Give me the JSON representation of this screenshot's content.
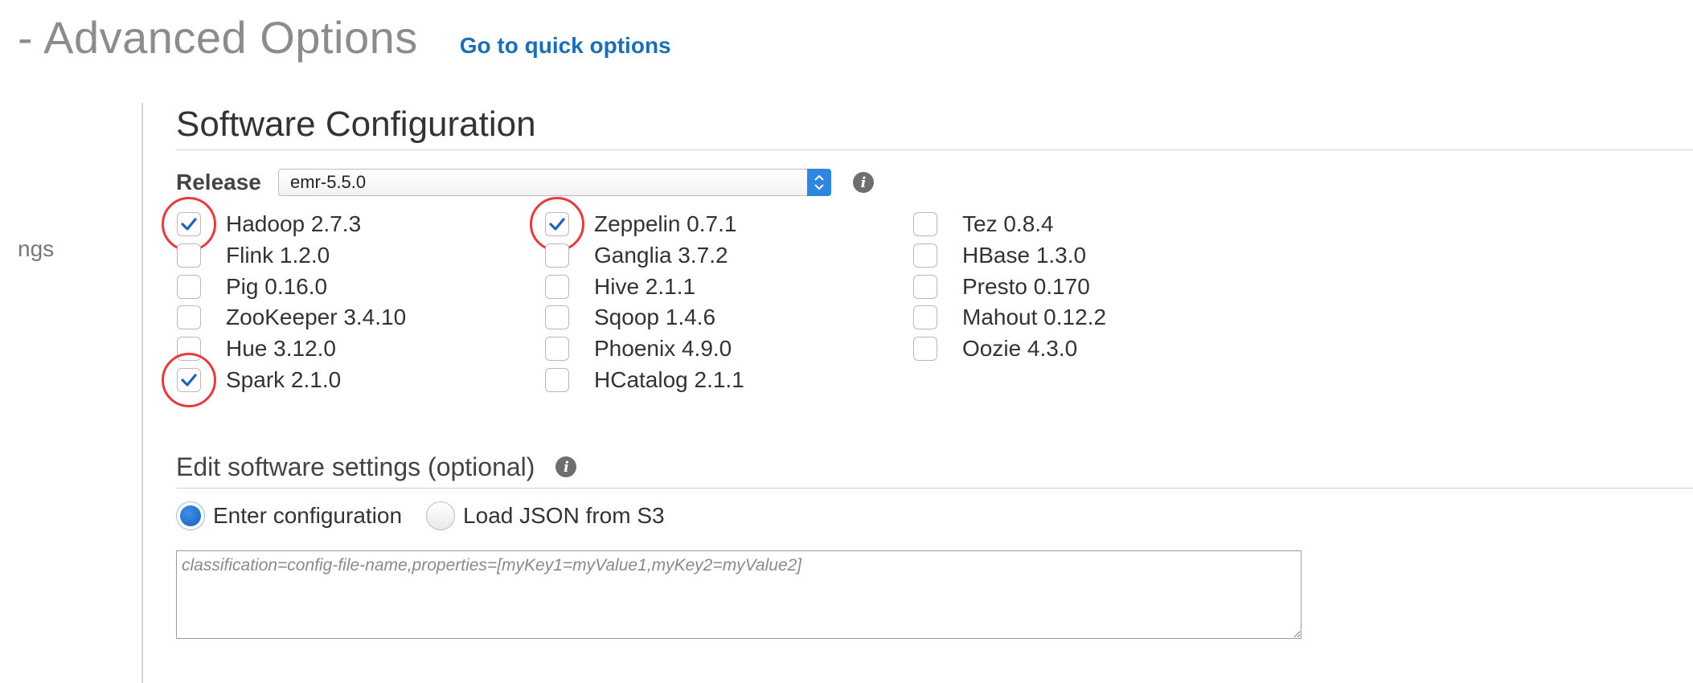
{
  "header": {
    "title": "- Advanced Options",
    "quick_link": "Go to quick options"
  },
  "sidebar": {
    "partial_label": "ngs"
  },
  "software_config": {
    "title": "Software Configuration",
    "release_label": "Release",
    "release_value": "emr-5.5.0",
    "applications": [
      {
        "label": "Hadoop 2.7.3",
        "checked": true,
        "highlighted": true
      },
      {
        "label": "Zeppelin 0.7.1",
        "checked": true,
        "highlighted": true
      },
      {
        "label": "Tez 0.8.4",
        "checked": false
      },
      {
        "label": "Flink 1.2.0",
        "checked": false
      },
      {
        "label": "Ganglia 3.7.2",
        "checked": false
      },
      {
        "label": "HBase 1.3.0",
        "checked": false
      },
      {
        "label": "Pig 0.16.0",
        "checked": false
      },
      {
        "label": "Hive 2.1.1",
        "checked": false
      },
      {
        "label": "Presto 0.170",
        "checked": false
      },
      {
        "label": "ZooKeeper 3.4.10",
        "checked": false
      },
      {
        "label": "Sqoop 1.4.6",
        "checked": false
      },
      {
        "label": "Mahout 0.12.2",
        "checked": false
      },
      {
        "label": "Hue 3.12.0",
        "checked": false
      },
      {
        "label": "Phoenix 4.9.0",
        "checked": false
      },
      {
        "label": "Oozie 4.3.0",
        "checked": false
      },
      {
        "label": "Spark 2.1.0",
        "checked": true,
        "highlighted": true
      },
      {
        "label": "HCatalog 2.1.1",
        "checked": false
      }
    ]
  },
  "edit_settings": {
    "title": "Edit software settings (optional)",
    "options": [
      {
        "label": "Enter configuration",
        "selected": true
      },
      {
        "label": "Load JSON from S3",
        "selected": false
      }
    ],
    "config_placeholder": "classification=config-file-name,properties=[myKey1=myValue1,myKey2=myValue2]",
    "config_value": ""
  },
  "colors": {
    "accent": "#1a6fb7",
    "checkmark": "#1c63b7",
    "highlight_ring": "#e8393d",
    "title_gray": "#8c8c8c"
  },
  "icons": {
    "release_info": "info-icon",
    "settings_info": "info-icon",
    "select_arrows": "chevron-up-down-icon",
    "checkmark": "check-icon"
  }
}
